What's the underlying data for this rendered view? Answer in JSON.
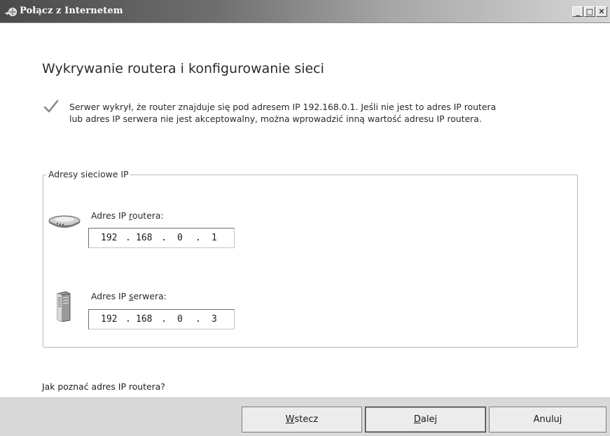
{
  "window": {
    "title": "Połącz z Internetem",
    "controls": {
      "minimize": "_",
      "maximize": "□",
      "close": "✕"
    }
  },
  "heading": "Wykrywanie routera i konfigurowanie sieci",
  "info": {
    "icon": "check-icon",
    "line1": "Serwer wykrył, że router znajduje się pod adresem IP 192.168.0.1. Jeśli nie jest to adres IP routera",
    "line2": "lub adres IP serwera nie jest akceptowalny, można wprowadzić inną wartość adresu IP routera."
  },
  "group": {
    "legend": "Adresy sieciowe IP",
    "router": {
      "icon": "router-icon",
      "label_pre": "Adres IP ",
      "label_mnemonic": "r",
      "label_post": "outera:",
      "octets": [
        "192",
        "168",
        "0",
        "1"
      ]
    },
    "server": {
      "icon": "server-icon",
      "label_pre": "Adres IP ",
      "label_mnemonic": "s",
      "label_post": "erwera:",
      "octets": [
        "192",
        "168",
        "0",
        "3"
      ]
    },
    "separator": "."
  },
  "help_link": "Jak poznać adres IP routera?",
  "buttons": {
    "back": {
      "mnemonic": "W",
      "rest": "stecz"
    },
    "next": {
      "mnemonic": "D",
      "rest": "alej"
    },
    "cancel": "Anuluj"
  },
  "colors": {
    "titlebar_dark": "#4a4a4a",
    "bottom_bar": "#d9d9d9",
    "groupbox_border": "#b8b8b8"
  }
}
